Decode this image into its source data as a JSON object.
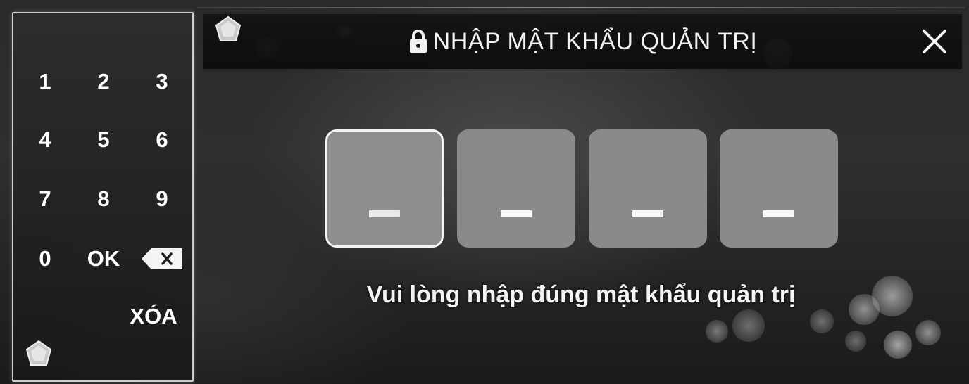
{
  "dialog": {
    "title": "NHẬP MẬT KHẨU QUẢN TRỊ",
    "message": "Vui lòng nhập đúng mật khẩu quản trị",
    "close_icon": "close-icon",
    "title_icon": "lock-icon"
  },
  "pin": {
    "length": 4,
    "active_index": 0,
    "placeholder": "_"
  },
  "keypad": {
    "k1": "1",
    "k2": "2",
    "k3": "3",
    "k4": "4",
    "k5": "5",
    "k6": "6",
    "k7": "7",
    "k8": "8",
    "k9": "9",
    "k0": "0",
    "ok": "OK",
    "backspace_icon": "backspace-icon",
    "clear": "XÓA"
  },
  "colors": {
    "text": "#ffffff",
    "pin_box": "#8a8a8a",
    "pin_active_border": "#f4f4f4"
  }
}
